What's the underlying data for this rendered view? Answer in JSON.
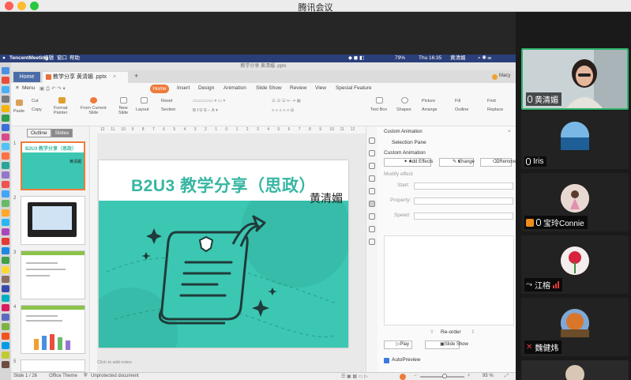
{
  "meeting": {
    "title": "腾讯会议"
  },
  "mac_menubar": {
    "app": "TencentMeeting",
    "menus": [
      "编辑",
      "窗口",
      "帮助"
    ],
    "battery": "79%",
    "clock": "Thu 16:35",
    "user": "黄清媚"
  },
  "wps": {
    "window_title": "教学分享 黄清媚 .pptx",
    "home_tab": "Home",
    "doc_tab": "教学分享 黄清媚 .pptx",
    "user_name": "Macy",
    "menu_label": "Menu",
    "ribbon_tabs": [
      "Home",
      "Insert",
      "Design",
      "Animation",
      "Slide Show",
      "Review",
      "View",
      "Special Feature"
    ],
    "ribbon": {
      "paste": "Paste",
      "cut": "Cut",
      "copy": "Copy",
      "format_painter": "Format\nPainter",
      "from_current": "From Current\nSlide",
      "new_slide": "New\nSlide",
      "layout": "Layout",
      "reset": "Reset",
      "section": "Section",
      "text_box": "Text Box",
      "shapes": "Shapes",
      "picture": "Picture",
      "arrange": "Arrange",
      "fill": "Fill",
      "outline": "Outline",
      "find": "Find",
      "replace": "Replace"
    },
    "panel_tabs": {
      "outline": "Outline",
      "slides": "Slides"
    },
    "ruler_marks": [
      "12",
      "11",
      "10",
      "9",
      "8",
      "7",
      "6",
      "5",
      "4",
      "3",
      "2",
      "1",
      "0",
      "1",
      "2",
      "3",
      "4",
      "5",
      "6",
      "7",
      "8",
      "9",
      "10",
      "11",
      "12"
    ],
    "thumbnails": [
      {
        "num": "1",
        "title": "B2U3 教学分享（思政）",
        "name": "黄清媚"
      },
      {
        "num": "2"
      },
      {
        "num": "3"
      },
      {
        "num": "4"
      },
      {
        "num": "5"
      }
    ],
    "slide": {
      "title": "B2U3 教学分享（思政）",
      "presenter": "黄清媚"
    },
    "notes_placeholder": "Click to add notes",
    "animation_panel": {
      "header": "Custom Animation",
      "selection_pane": "Selection Pane",
      "section_title": "Custom Animation",
      "add_effects": "Add Effects",
      "change": "Change",
      "remove": "Remove",
      "modify_effect": "Modify effect",
      "start_label": "Start:",
      "property_label": "Property:",
      "speed_label": "Speed:",
      "reorder": "Re-order",
      "play": "Play",
      "slide_show": "Slide Show",
      "autopreview": "AutoPreview"
    },
    "statusbar": {
      "slide_counter": "Slide 1 / 26",
      "theme": "Office Theme",
      "protection": "Unprotected document",
      "zoom": "95 %"
    }
  },
  "participants": [
    {
      "name": "黄清媚",
      "mic": "on",
      "video": true,
      "speaking": true
    },
    {
      "name": "Iris",
      "mic": "on",
      "avatar_color": "#3b7fb8"
    },
    {
      "name": "宝玲Connie",
      "mic": "on",
      "host": true,
      "avatar_color": "#d8b7b0"
    },
    {
      "name": "江榕",
      "mic": "speaking",
      "avatar_color": "#d23a4c"
    },
    {
      "name": "魏健炜",
      "mic": "muted",
      "avatar_color": "#c8873a"
    }
  ],
  "colors": {
    "slide_teal": "#3cc7b3",
    "title_teal": "#36b6a2",
    "ribbon_accent": "#ee7b3a",
    "speaking_border": "#2fb26a",
    "mac_menubar": "#2a3f7a"
  }
}
